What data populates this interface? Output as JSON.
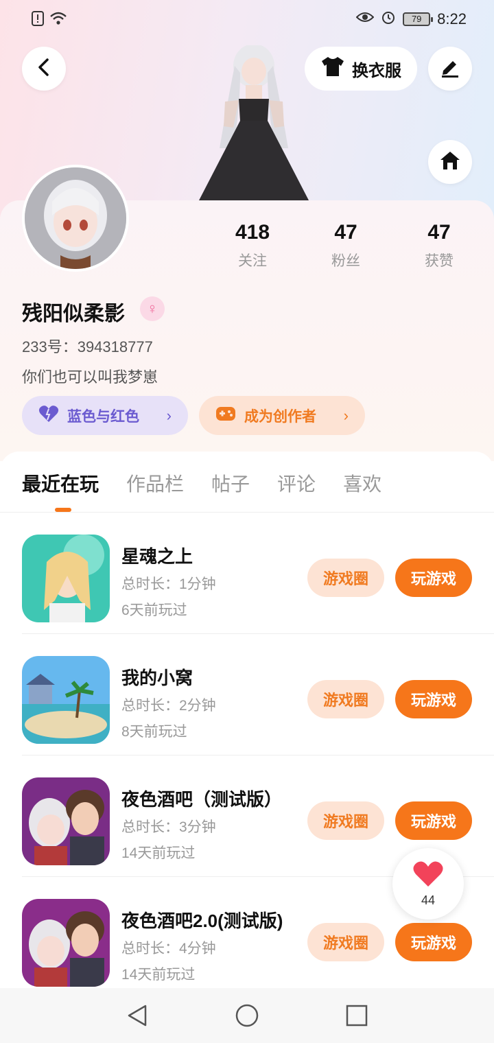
{
  "statusbar": {
    "time": "8:22",
    "battery": "79"
  },
  "header": {
    "dress_label": "换衣服"
  },
  "profile": {
    "stats": [
      {
        "value": "418",
        "label": "关注"
      },
      {
        "value": "47",
        "label": "粉丝"
      },
      {
        "value": "47",
        "label": "获赞"
      }
    ],
    "username": "残阳似柔影",
    "gender_symbol": "♀",
    "uid": "233号：394318777",
    "bio": "你们也可以叫我梦崽",
    "tag_blue": "蓝色与红色",
    "tag_orange": "成为创作者"
  },
  "tabs": [
    "最近在玩",
    "作品栏",
    "帖子",
    "评论",
    "喜欢"
  ],
  "games": [
    {
      "title": "星魂之上",
      "duration": "总时长：1分钟",
      "last_played": "6天前玩过"
    },
    {
      "title": "我的小窝",
      "duration": "总时长：2分钟",
      "last_played": "8天前玩过"
    },
    {
      "title": "夜色酒吧（测试版）",
      "duration": "总时长：3分钟",
      "last_played": "14天前玩过"
    },
    {
      "title": "夜色酒吧2.0(测试版)",
      "duration": "总时长：4分钟",
      "last_played": "14天前玩过"
    }
  ],
  "game_actions": {
    "circle": "游戏圈",
    "play": "玩游戏"
  },
  "like_float": {
    "count": "44"
  },
  "colors": {
    "accent": "#f6761a",
    "accent_light": "#fde3d4",
    "purple": "#6b5bd0"
  }
}
